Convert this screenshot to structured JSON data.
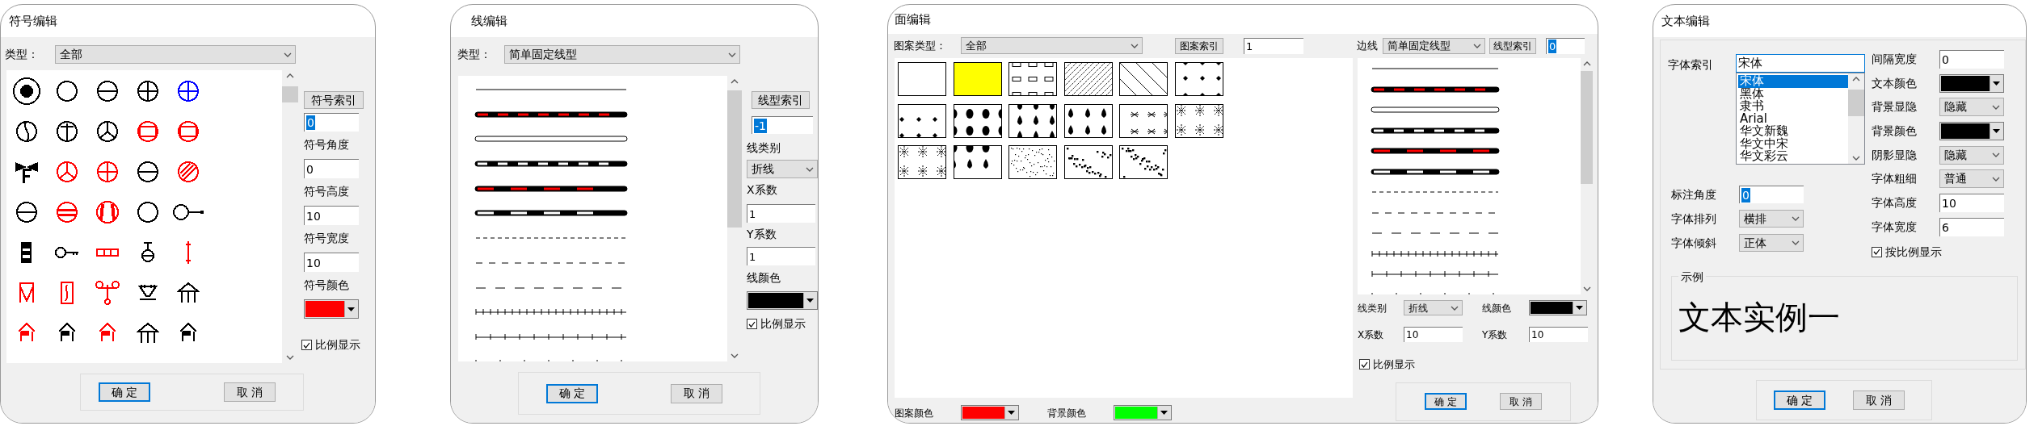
{
  "symbol_editor": {
    "title": "符号编辑",
    "type_label": "类型：",
    "type_value": "全部",
    "symbols": [
      {
        "color": "#000000"
      },
      {
        "color": "#000000"
      },
      {
        "color": "#000000"
      },
      {
        "color": "#000000"
      },
      {
        "color": "#0000ff"
      },
      {
        "color": "#000000"
      },
      {
        "color": "#000000"
      },
      {
        "color": "#000000"
      },
      {
        "color": "#ff0000"
      },
      {
        "color": "#ff0000"
      },
      {
        "color": "#000000"
      },
      {
        "color": "#ff0000"
      },
      {
        "color": "#ff0000"
      },
      {
        "color": "#000000"
      },
      {
        "color": "#ff0000"
      },
      {
        "color": "#000000"
      },
      {
        "color": "#ff0000"
      },
      {
        "color": "#ff0000"
      },
      {
        "color": "#000000"
      },
      {
        "color": "#000000"
      },
      {
        "color": "#000000"
      },
      {
        "color": "#000000"
      },
      {
        "color": "#ff0000"
      },
      {
        "color": "#000000"
      },
      {
        "color": "#ff0000"
      },
      {
        "color": "#ff0000"
      },
      {
        "color": "#ff0000"
      },
      {
        "color": "#ff0000"
      },
      {
        "color": "#000000"
      },
      {
        "color": "#000000"
      },
      {
        "color": "#ff0000"
      },
      {
        "color": "#000000"
      },
      {
        "color": "#ff0000"
      },
      {
        "color": "#000000"
      },
      {
        "color": "#000000"
      }
    ],
    "index_button": "符号索引",
    "index_field": {
      "value": "0",
      "text_selected": true
    },
    "fields": [
      {
        "label": "符号角度",
        "value": "0",
        "text_selected": false
      },
      {
        "label": "符号高度",
        "value": "10",
        "text_selected": false
      },
      {
        "label": "符号宽度",
        "value": "10",
        "text_selected": false
      }
    ],
    "color_label": "符号颜色",
    "color": "#ff0000",
    "scale_checkbox": {
      "label": "比例显示",
      "checked": true
    },
    "buttons": [
      {
        "label": "确 定",
        "default": true
      },
      {
        "label": "取 消",
        "default": false
      }
    ]
  },
  "line_editor": {
    "title": "线编辑",
    "type_label": "类型：",
    "type_value": "简单固定线型",
    "index_button": "线型索引",
    "index_field": {
      "value": "-1",
      "text_selected": true
    },
    "category_label": "线类别",
    "category_value": "折线",
    "x_label": "X系数",
    "x_field": {
      "value": "1",
      "text_selected": false
    },
    "y_label": "Y系数",
    "y_field": {
      "value": "1",
      "text_selected": false
    },
    "color_label": "线颜色",
    "color": "#000000",
    "scale_checkbox": {
      "label": "比例显示",
      "checked": true
    },
    "buttons": [
      {
        "label": "确 定",
        "default": true
      },
      {
        "label": "取 消",
        "default": false
      }
    ]
  },
  "fill_editor": {
    "title": "面编辑",
    "pattern_type_label": "图案类型：",
    "pattern_type_value": "全部",
    "pattern_index_button": "图案索引",
    "pattern_index_field": {
      "value": "1",
      "text_selected": false
    },
    "border_label": "边线",
    "border_type_value": "简单固定线型",
    "line_index_button": "线型索引",
    "line_index_field": {
      "value": "0",
      "text_selected": true
    },
    "category_label": "线类别",
    "category_value": "折线",
    "line_color_label": "线颜色",
    "line_color_picker": {
      "color": "#000000"
    },
    "x_label": "X系数",
    "x_field": {
      "value": "10",
      "text_selected": false
    },
    "y_label": "Y系数",
    "y_field": {
      "value": "10",
      "text_selected": false
    },
    "scale_checkbox": {
      "label": "比例显示",
      "checked": true
    },
    "pattern_color_label": "图案颜色",
    "pattern_color_picker": {
      "color": "#ff0000"
    },
    "background_color_label": "背景颜色",
    "background_color_picker": {
      "color": "#00ff00"
    },
    "buttons": [
      {
        "label": "确 定",
        "default": true
      },
      {
        "label": "取 消",
        "default": false
      }
    ]
  },
  "text_editor": {
    "title": "文本编辑",
    "font_label": "字体索引",
    "font_value": "宋体",
    "fonts": [
      {
        "label": "宋体",
        "selected": true
      },
      {
        "label": "黑体",
        "selected": false
      },
      {
        "label": "隶书",
        "selected": false
      },
      {
        "label": "Arial",
        "selected": false
      },
      {
        "label": "华文新魏",
        "selected": false
      },
      {
        "label": "华文中宋",
        "selected": false
      },
      {
        "label": "华文彩云",
        "selected": false
      }
    ],
    "left_fields": [
      {
        "kind": "input",
        "label": "标注角度",
        "value": "0",
        "text_selected": true
      },
      {
        "kind": "select",
        "label": "字体排列",
        "value": "横排"
      },
      {
        "kind": "select",
        "label": "字体倾斜",
        "value": "正体"
      }
    ],
    "right_fields": [
      {
        "kind": "input",
        "label": "间隔宽度",
        "value": "0",
        "text_selected": false
      },
      {
        "kind": "color",
        "label": "文本颜色",
        "color": "#000000"
      },
      {
        "kind": "select",
        "label": "背景显隐",
        "value": "隐藏"
      },
      {
        "kind": "color",
        "label": "背景颜色",
        "color": "#000000"
      },
      {
        "kind": "select",
        "label": "阴影显隐",
        "value": "隐藏"
      },
      {
        "kind": "select",
        "label": "字体粗细",
        "value": "普通"
      },
      {
        "kind": "input",
        "label": "字体高度",
        "value": "10",
        "text_selected": false
      },
      {
        "kind": "input",
        "label": "字体宽度",
        "value": "6",
        "text_selected": false
      }
    ],
    "scale_checkbox": {
      "label": "按比例显示",
      "checked": true
    },
    "sample_label": "示例",
    "sample_text": "文本实例一",
    "buttons": [
      {
        "label": "确 定",
        "default": true
      },
      {
        "label": "取 消",
        "default": false
      }
    ]
  }
}
